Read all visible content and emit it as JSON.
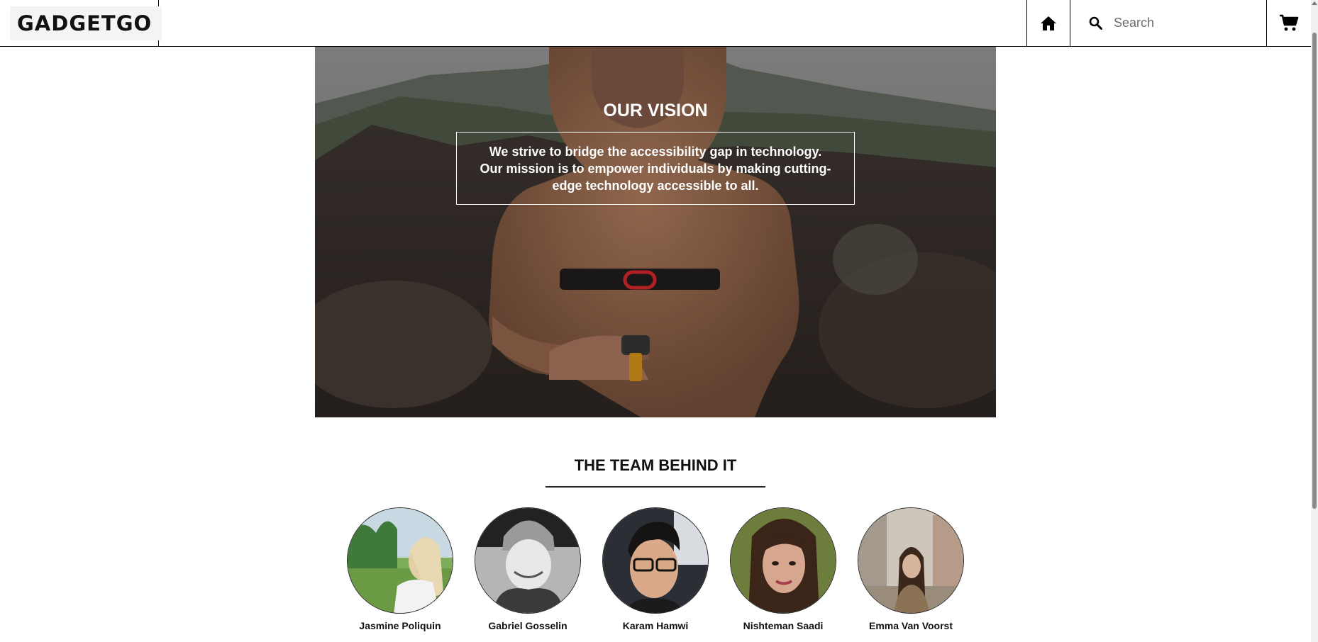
{
  "header": {
    "logo": "GADGETGO",
    "search_placeholder": "Search",
    "icons": [
      "home-icon",
      "search-icon",
      "cart-icon"
    ]
  },
  "hero": {
    "title": "OUR VISION",
    "text": "We strive to bridge the accessibility gap in technology. Our mission is to empower individuals by making cutting-edge technology accessible to all."
  },
  "team": {
    "title": "THE TEAM BEHIND IT",
    "members": [
      {
        "name": "Jasmine Poliquin"
      },
      {
        "name": "Gabriel Gosselin"
      },
      {
        "name": "Karam Hamwi"
      },
      {
        "name": "Nishteman Saadi"
      },
      {
        "name": "Emma Van Voorst"
      }
    ]
  },
  "colors": {
    "text": "#000000",
    "background": "#ffffff",
    "overlay_text": "#ffffff"
  }
}
